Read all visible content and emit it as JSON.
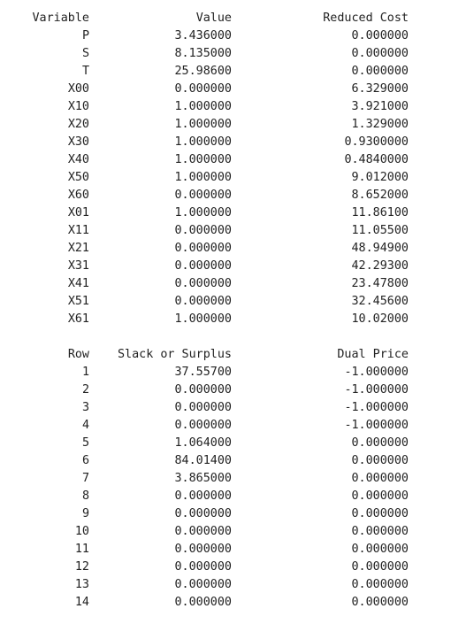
{
  "variables": {
    "headers": {
      "variable": "Variable",
      "value": "Value",
      "reduced_cost": "Reduced Cost"
    },
    "rows": [
      {
        "name": "P",
        "value": "3.436000",
        "reduced_cost": "0.000000"
      },
      {
        "name": "S",
        "value": "8.135000",
        "reduced_cost": "0.000000"
      },
      {
        "name": "T",
        "value": "25.98600",
        "reduced_cost": "0.000000"
      },
      {
        "name": "X00",
        "value": "0.000000",
        "reduced_cost": "6.329000"
      },
      {
        "name": "X10",
        "value": "1.000000",
        "reduced_cost": "3.921000"
      },
      {
        "name": "X20",
        "value": "1.000000",
        "reduced_cost": "1.329000"
      },
      {
        "name": "X30",
        "value": "1.000000",
        "reduced_cost": "0.9300000"
      },
      {
        "name": "X40",
        "value": "1.000000",
        "reduced_cost": "0.4840000"
      },
      {
        "name": "X50",
        "value": "1.000000",
        "reduced_cost": "9.012000"
      },
      {
        "name": "X60",
        "value": "0.000000",
        "reduced_cost": "8.652000"
      },
      {
        "name": "X01",
        "value": "1.000000",
        "reduced_cost": "11.86100"
      },
      {
        "name": "X11",
        "value": "0.000000",
        "reduced_cost": "11.05500"
      },
      {
        "name": "X21",
        "value": "0.000000",
        "reduced_cost": "48.94900"
      },
      {
        "name": "X31",
        "value": "0.000000",
        "reduced_cost": "42.29300"
      },
      {
        "name": "X41",
        "value": "0.000000",
        "reduced_cost": "23.47800"
      },
      {
        "name": "X51",
        "value": "0.000000",
        "reduced_cost": "32.45600"
      },
      {
        "name": "X61",
        "value": "1.000000",
        "reduced_cost": "10.02000"
      }
    ]
  },
  "constraints": {
    "headers": {
      "row": "Row",
      "slack": "Slack or Surplus",
      "dual_price": "Dual Price"
    },
    "rows": [
      {
        "row": "1",
        "slack": "37.55700",
        "dual_price": "-1.000000"
      },
      {
        "row": "2",
        "slack": "0.000000",
        "dual_price": "-1.000000"
      },
      {
        "row": "3",
        "slack": "0.000000",
        "dual_price": "-1.000000"
      },
      {
        "row": "4",
        "slack": "0.000000",
        "dual_price": "-1.000000"
      },
      {
        "row": "5",
        "slack": "1.064000",
        "dual_price": "0.000000"
      },
      {
        "row": "6",
        "slack": "84.01400",
        "dual_price": "0.000000"
      },
      {
        "row": "7",
        "slack": "3.865000",
        "dual_price": "0.000000"
      },
      {
        "row": "8",
        "slack": "0.000000",
        "dual_price": "0.000000"
      },
      {
        "row": "9",
        "slack": "0.000000",
        "dual_price": "0.000000"
      },
      {
        "row": "10",
        "slack": "0.000000",
        "dual_price": "0.000000"
      },
      {
        "row": "11",
        "slack": "0.000000",
        "dual_price": "0.000000"
      },
      {
        "row": "12",
        "slack": "0.000000",
        "dual_price": "0.000000"
      },
      {
        "row": "13",
        "slack": "0.000000",
        "dual_price": "0.000000"
      },
      {
        "row": "14",
        "slack": "0.000000",
        "dual_price": "0.000000"
      }
    ]
  }
}
